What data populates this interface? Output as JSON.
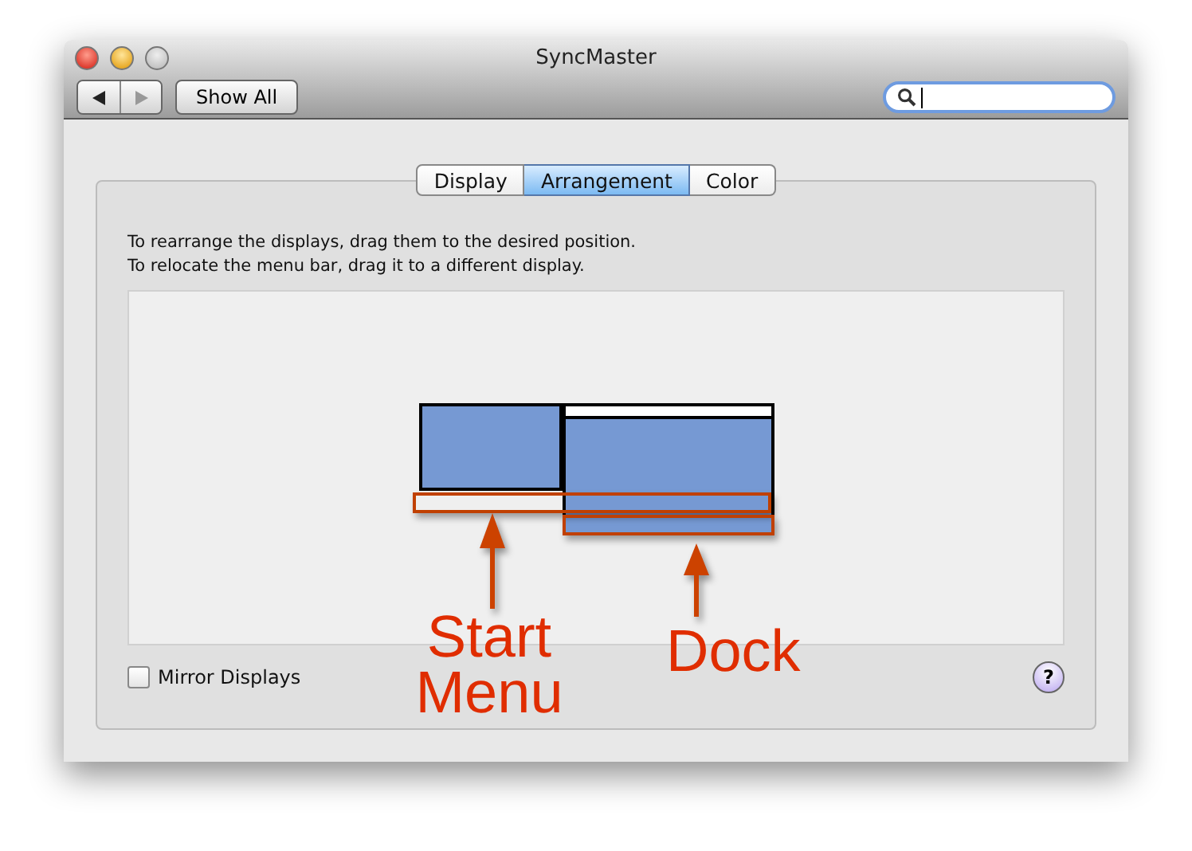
{
  "window": {
    "title": "SyncMaster"
  },
  "toolbar": {
    "show_all": "Show All"
  },
  "tabs": [
    {
      "label": "Display",
      "selected": false
    },
    {
      "label": "Arrangement",
      "selected": true
    },
    {
      "label": "Color",
      "selected": false
    }
  ],
  "instructions": [
    "To rearrange the displays, drag them to the desired position.",
    "To relocate the menu bar, drag it to a different display."
  ],
  "displays": [
    {
      "menu_bar": false
    },
    {
      "menu_bar": true
    }
  ],
  "mirror": {
    "label": "Mirror Displays",
    "checked": false
  },
  "help": "?",
  "annotations": [
    {
      "text": "Start Menu"
    },
    {
      "text": "Dock"
    }
  ]
}
